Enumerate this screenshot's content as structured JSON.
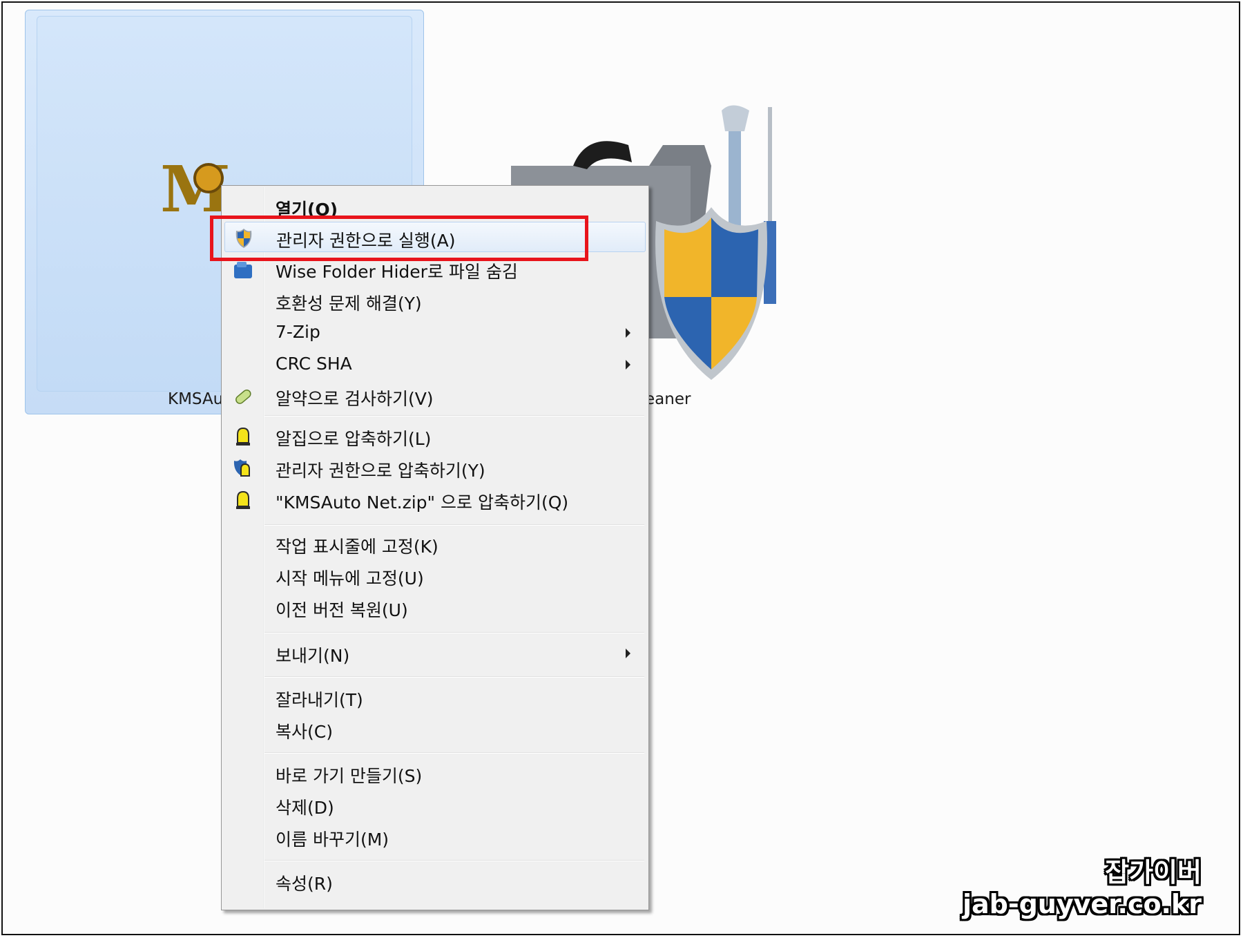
{
  "desktop": {
    "items": [
      {
        "label": "KMSAu",
        "selected": true
      },
      {
        "label": "eaner",
        "selected": false
      }
    ]
  },
  "context_menu": {
    "groups": [
      [
        {
          "label": "열기(O)",
          "bold": true
        },
        {
          "label": "관리자 권한으로 실행(A)",
          "icon": "uac-shield-icon",
          "highlighted": true
        },
        {
          "label": "Wise Folder Hider로 파일 숨김",
          "icon": "wise-folder-icon"
        },
        {
          "label": "호환성 문제 해결(Y)"
        },
        {
          "label": "7-Zip",
          "submenu": true
        },
        {
          "label": "CRC SHA",
          "submenu": true
        },
        {
          "label": "알약으로 검사하기(V)",
          "icon": "alyac-pill-icon"
        }
      ],
      [
        {
          "label": "알집으로 압축하기(L)",
          "icon": "alzip-icon"
        },
        {
          "label": "관리자 권한으로 압축하기(Y)",
          "icon": "alzip-admin-icon"
        },
        {
          "label": "\"KMSAuto Net.zip\" 으로 압축하기(Q)",
          "icon": "alzip-icon"
        }
      ],
      [
        {
          "label": "작업 표시줄에 고정(K)"
        },
        {
          "label": "시작 메뉴에 고정(U)"
        },
        {
          "label": "이전 버전 복원(U)"
        }
      ],
      [
        {
          "label": "보내기(N)",
          "submenu": true
        }
      ],
      [
        {
          "label": "잘라내기(T)"
        },
        {
          "label": "복사(C)"
        }
      ],
      [
        {
          "label": "바로 가기 만들기(S)"
        },
        {
          "label": "삭제(D)"
        },
        {
          "label": "이름 바꾸기(M)"
        }
      ],
      [
        {
          "label": "속성(R)"
        }
      ]
    ]
  },
  "watermark": {
    "title": "잡가이버",
    "url": "jab-guyver.co.kr"
  },
  "colors": {
    "highlight_border": "#e8141b",
    "selection_fill": "#cfe3f9",
    "menu_bg": "#f0f0f0"
  }
}
